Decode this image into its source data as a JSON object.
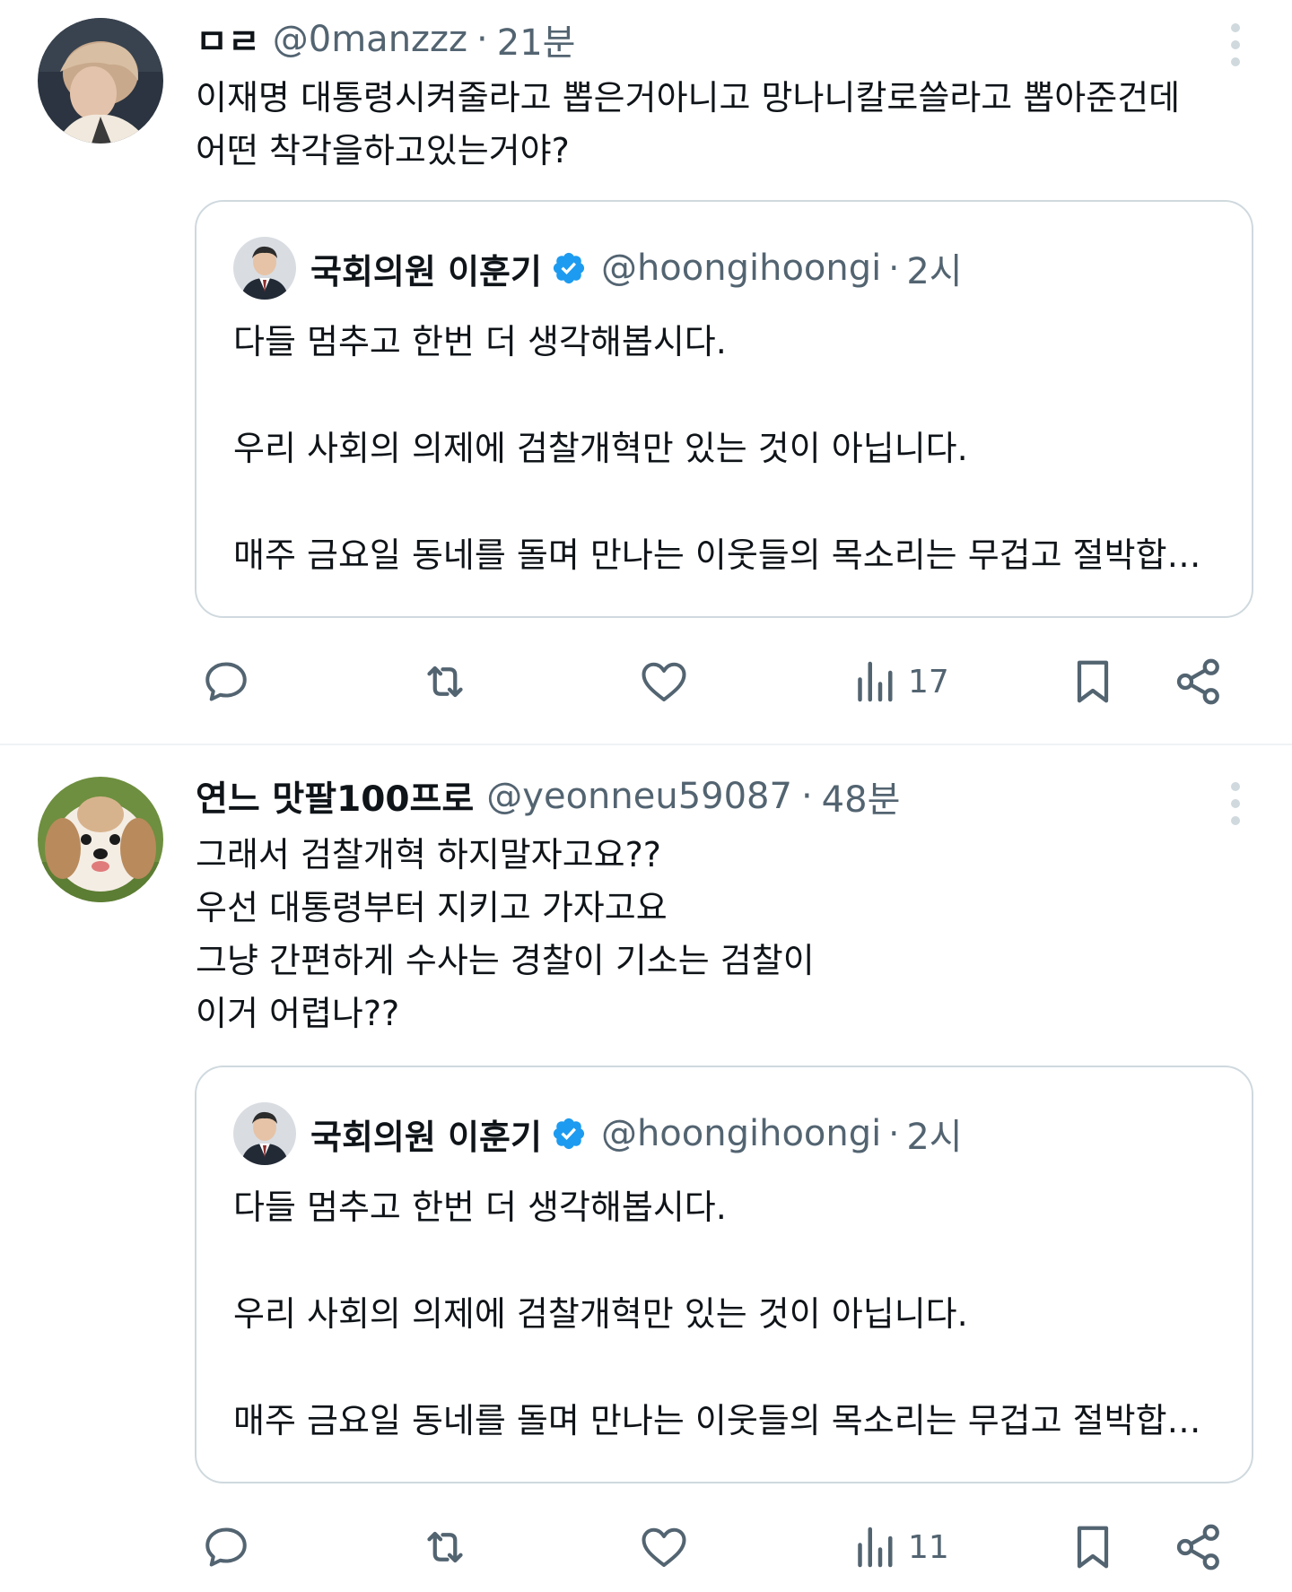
{
  "tweets": [
    {
      "name": "ㅁㄹ",
      "handle": "@0manzzz",
      "separator": "·",
      "time": "21분",
      "lines": [
        "이재명 대통령시켜줄라고 뽑은거아니고 망나니칼로쓸라고 뽑아준건데",
        "어떤 착각을하고있는거야?"
      ],
      "quote": {
        "name": "국회의원 이훈기",
        "handle": "@hoongihoongi",
        "separator": "·",
        "time": "2시",
        "lines": [
          "다들 멈추고 한번 더 생각해봅시다.",
          "우리 사회의 의제에 검찰개혁만 있는 것이 아닙니다.",
          "매주 금요일 동네를 돌며 만나는 이웃들의 목소리는 무겁고 절박합…"
        ]
      },
      "views": "17"
    },
    {
      "name": "연느 맛팔100프로",
      "handle": "@yeonneu59087",
      "separator": "·",
      "time": "48분",
      "lines": [
        "그래서 검찰개혁 하지말자고요??",
        "우선 대통령부터 지키고 가자고요",
        "그냥 간편하게 수사는 경찰이 기소는 검찰이",
        "이거 어렵나??"
      ],
      "quote": {
        "name": "국회의원 이훈기",
        "handle": "@hoongihoongi",
        "separator": "·",
        "time": "2시",
        "lines": [
          "다들 멈추고 한번 더 생각해봅시다.",
          "우리 사회의 의제에 검찰개혁만 있는 것이 아닙니다.",
          "매주 금요일 동네를 돌며 만나는 이웃들의 목소리는 무겁고 절박합…"
        ]
      },
      "views": "11"
    }
  ],
  "icons": {
    "reply": "speech-bubble-icon",
    "retweet": "retweet-icon",
    "like": "heart-icon",
    "views": "bar-chart-icon",
    "bookmark": "bookmark-icon",
    "share": "share-icon",
    "more": "more-vertical-icon",
    "verified": "verified-badge-icon"
  },
  "colors": {
    "text": "#0f1419",
    "muted": "#536471",
    "border": "#cfd9de",
    "verified": "#1d9bf0"
  }
}
